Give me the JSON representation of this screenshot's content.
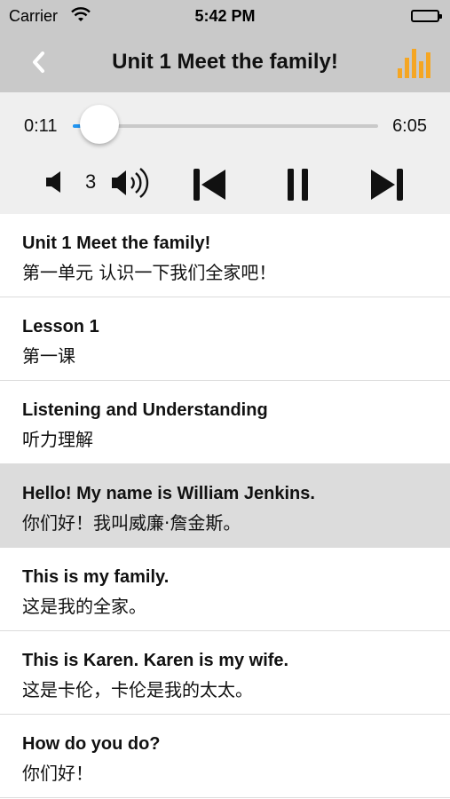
{
  "status_bar": {
    "carrier": "Carrier",
    "time": "5:42 PM",
    "wifi_icon": "wifi-icon",
    "battery_icon": "battery-icon"
  },
  "nav": {
    "title": "Unit 1  Meet the family!",
    "back_icon": "chevron-left-icon",
    "chart_icon": "bar-chart-icon",
    "accent_color": "#f5a623"
  },
  "player": {
    "elapsed": "0:11",
    "duration": "6:05",
    "progress_fraction": 0.03,
    "volume_level": "3",
    "progress_color": "#2196f3"
  },
  "items": [
    {
      "en": "Unit 1 Meet the family!",
      "zh": "第一单元 认识一下我们全家吧！",
      "selected": false
    },
    {
      "en": "Lesson 1",
      "zh": "第一课",
      "selected": false
    },
    {
      "en": "Listening and Understanding",
      "zh": "听力理解",
      "selected": false
    },
    {
      "en": "Hello! My name is William Jenkins.",
      "zh": "你们好！我叫威廉·詹金斯。",
      "selected": true
    },
    {
      "en": "This is my family.",
      "zh": "这是我的全家。",
      "selected": false
    },
    {
      "en": "This is Karen. Karen is my wife.",
      "zh": "这是卡伦，卡伦是我的太太。",
      "selected": false
    },
    {
      "en": "How do you do?",
      "zh": "你们好！",
      "selected": false
    }
  ]
}
